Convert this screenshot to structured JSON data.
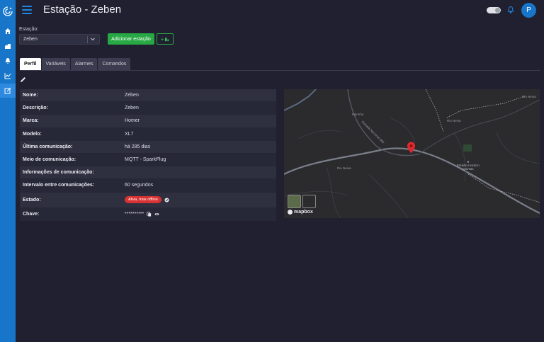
{
  "header": {
    "title": "Estação - Zeben",
    "avatar_letter": "P"
  },
  "station": {
    "label": "Estação:",
    "selected": "Zeben",
    "add_button": "Adicionar estação",
    "add_alt_button": "+"
  },
  "tabs": [
    {
      "label": "Perfil",
      "active": true
    },
    {
      "label": "Variáveis",
      "active": false
    },
    {
      "label": "Alarmes",
      "active": false
    },
    {
      "label": "Comandos",
      "active": false
    }
  ],
  "profile": {
    "rows": [
      {
        "key": "Nome:",
        "value": "Zeben"
      },
      {
        "key": "Descrição:",
        "value": "Zeben"
      },
      {
        "key": "Marca:",
        "value": "Homer"
      },
      {
        "key": "Modelo:",
        "value": "XL7"
      },
      {
        "key": "Última comunicação:",
        "value": "há 285 dias"
      },
      {
        "key": "Meio de comunicação:",
        "value": "MQTT - SparkPlug"
      },
      {
        "key": "Informações de comunicação:",
        "value": ""
      },
      {
        "key": "Intervalo entre comunicações:",
        "value": "60 segundos"
      },
      {
        "key": "Estado:",
        "value": "Ativa, mas offline"
      },
      {
        "key": "Chave:",
        "value": "**********"
      }
    ]
  },
  "map": {
    "labels": [
      "Rio Neiva",
      "Rio Neiva",
      "Rio Neiva",
      "Marinha",
      "Estrada Nacional 308"
    ],
    "poi": "Estádio Horácio\nQuintas",
    "attribution": "mapbox"
  },
  "colors": {
    "sidebar": "#1776c9",
    "accent": "#1e88e5",
    "success": "#27a844",
    "danger": "#d83232",
    "background": "#202030"
  }
}
